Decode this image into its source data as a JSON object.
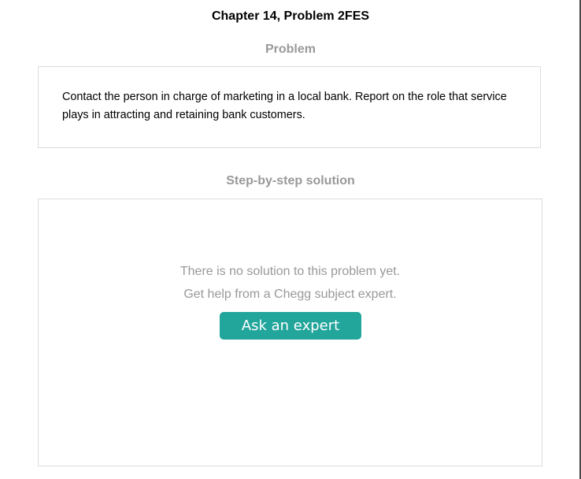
{
  "page": {
    "title": "Chapter 14, Problem 2FES"
  },
  "problem": {
    "heading": "Problem",
    "text": "Contact the person in charge of marketing in a local bank. Report on the role that service plays in attracting and retaining bank customers."
  },
  "solution": {
    "heading": "Step-by-step solution",
    "empty_line_1": "There is no solution to this problem yet.",
    "empty_line_2": "Get help from a Chegg subject expert.",
    "ask_button_label": "Ask an expert"
  },
  "colors": {
    "accent": "#22a59b",
    "heading_gray": "#999999",
    "border": "#dcdcdc"
  }
}
